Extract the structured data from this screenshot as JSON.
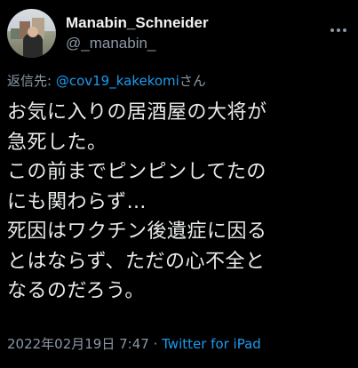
{
  "user": {
    "display_name": "Manabin_Schneider",
    "handle": "@_manabin_"
  },
  "reply": {
    "prefix": "返信先: ",
    "mention": "@cov19_kakekomi",
    "suffix": "さん"
  },
  "tweet": {
    "lines": [
      "お気に入りの居酒屋の大将が",
      "急死した。",
      "この前までピンピンしてたの",
      "にも関わらず…",
      "死因はワクチン後遺症に因る",
      "とはならず、ただの心不全と",
      "なるのだろう。"
    ]
  },
  "meta": {
    "timestamp": "2022年02月19日 7:47",
    "separator": " · ",
    "source": "Twitter for iPad"
  },
  "icons": {
    "avatar": "profile-avatar",
    "more": "more-options-icon"
  },
  "colors": {
    "background": "#000000",
    "text": "#e7e9ea",
    "muted": "#8b98a5",
    "link": "#1d9bf0"
  }
}
